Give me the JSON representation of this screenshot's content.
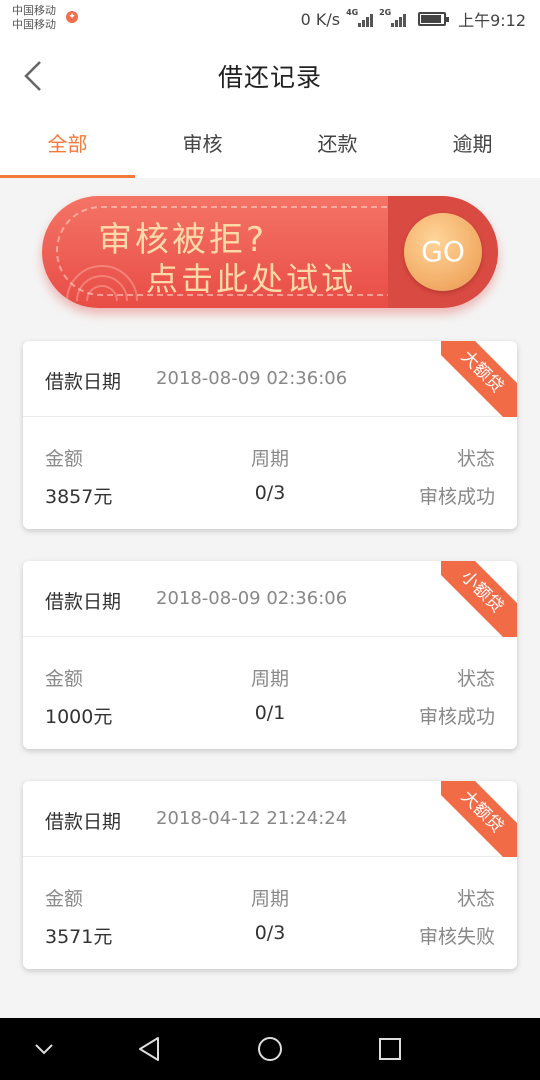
{
  "status_bar": {
    "carrier_1": "中国移动",
    "carrier_2": "中国移动",
    "net_speed": "0 K/s",
    "sig1_label": "4G",
    "sig2_label": "2G",
    "time": "上午9:12"
  },
  "header": {
    "title": "借还记录",
    "back_icon": "chevron-left-icon"
  },
  "tabs": [
    {
      "label": "全部",
      "active": true
    },
    {
      "label": "审核",
      "active": false
    },
    {
      "label": "还款",
      "active": false
    },
    {
      "label": "逾期",
      "active": false
    }
  ],
  "banner": {
    "line1": "审核被拒?",
    "line2": "点击此处试试",
    "go_label": "GO"
  },
  "records": [
    {
      "date_label": "借款日期",
      "date": "2018-08-09 02:36:06",
      "tag": "大额贷",
      "amount_label": "金额",
      "amount": "3857元",
      "period_label": "周期",
      "period": "0/3",
      "status_label": "状态",
      "status": "审核成功"
    },
    {
      "date_label": "借款日期",
      "date": "2018-08-09 02:36:06",
      "tag": "小额贷",
      "amount_label": "金额",
      "amount": "1000元",
      "period_label": "周期",
      "period": "0/1",
      "status_label": "状态",
      "status": "审核成功"
    },
    {
      "date_label": "借款日期",
      "date": "2018-04-12 21:24:24",
      "tag": "大额贷",
      "amount_label": "金额",
      "amount": "3571元",
      "period_label": "周期",
      "period": "0/3",
      "status_label": "状态",
      "status": "审核失败"
    }
  ],
  "colors": {
    "accent": "#f47a3c",
    "banner_red": "#e84c45",
    "tag_orange": "#f26b47"
  },
  "nav_bar": {
    "icons": [
      "chevron-down-icon",
      "back-triangle-icon",
      "home-circle-icon",
      "recents-square-icon"
    ]
  }
}
